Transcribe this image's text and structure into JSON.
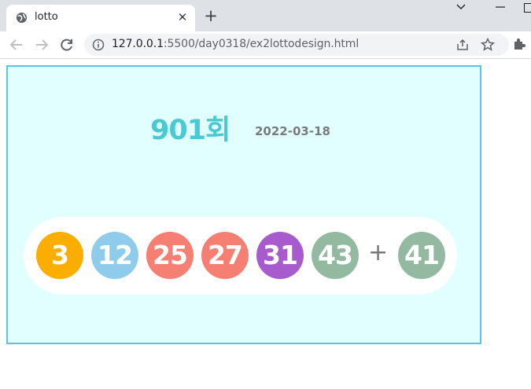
{
  "browser": {
    "tab_title": "lotto",
    "url_host": "127.0.0.1",
    "url_path": ":5500/day0318/ex2lottodesign.html"
  },
  "lotto": {
    "round_title": "901회",
    "date": "2022-03-18",
    "plus": "+",
    "balls": [
      {
        "number": "3",
        "color": "#fbae00"
      },
      {
        "number": "12",
        "color": "#8fcbea"
      },
      {
        "number": "25",
        "color": "#f47f72"
      },
      {
        "number": "27",
        "color": "#f47f72"
      },
      {
        "number": "31",
        "color": "#a85bcd"
      },
      {
        "number": "43",
        "color": "#93b9a1"
      }
    ],
    "bonus": {
      "number": "41",
      "color": "#93b9a1"
    }
  }
}
